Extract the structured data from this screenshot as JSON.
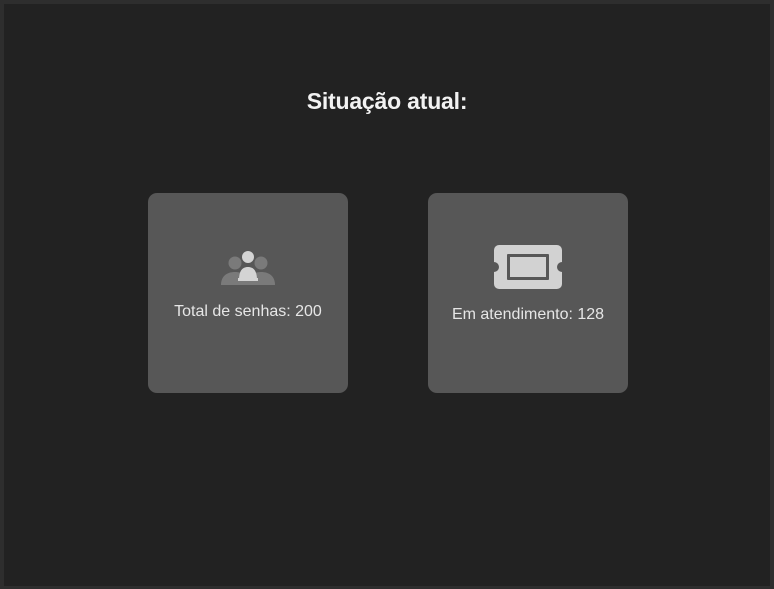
{
  "page": {
    "title": "Situação atual:"
  },
  "cards": [
    {
      "icon": "users-group-icon",
      "label": "Total de senhas: 200"
    },
    {
      "icon": "ticket-icon",
      "label": "Em atendimento: 128"
    }
  ],
  "colors": {
    "background": "#222222",
    "frame": "#2e2e2e",
    "card": "#575757",
    "icon_users": "#7a7a7a",
    "icon_users_front": "#d4d4d4",
    "icon_ticket": "#d2d2d2",
    "text": "#e6e6e6"
  }
}
